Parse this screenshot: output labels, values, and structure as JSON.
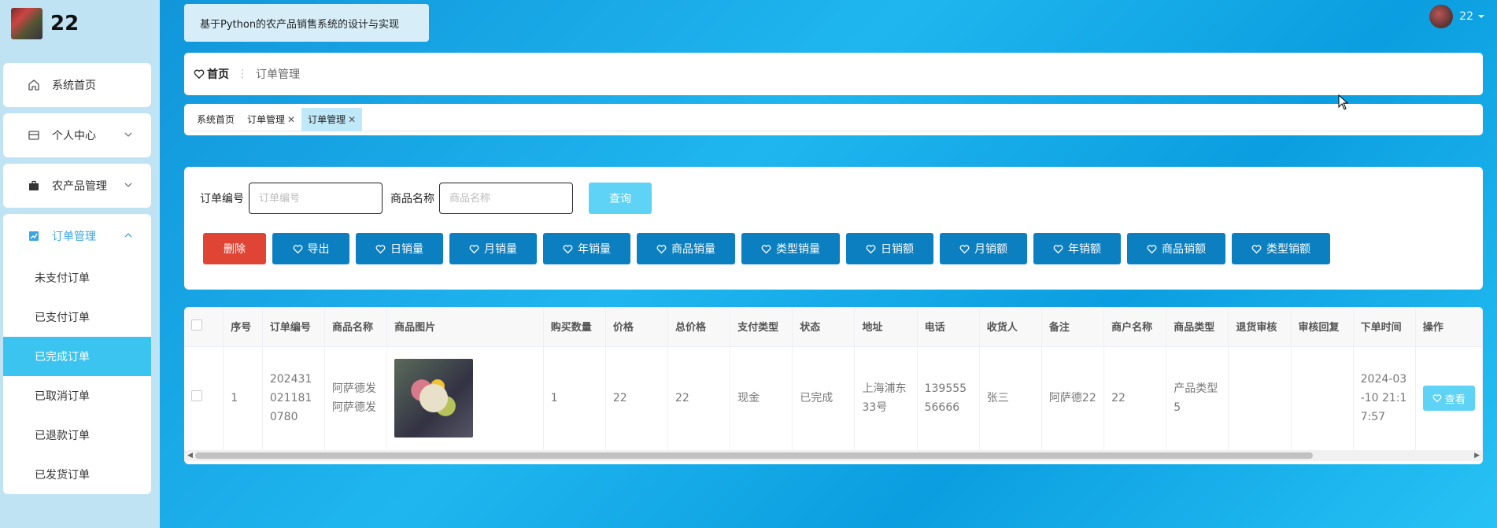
{
  "brand": {
    "name": "22"
  },
  "menu": {
    "items": [
      {
        "label": "系统首页",
        "icon": "home-icon"
      },
      {
        "label": "个人中心",
        "icon": "card-icon"
      },
      {
        "label": "农产品管理",
        "icon": "briefcase-icon"
      }
    ],
    "order_group": {
      "label": "订单管理",
      "icon": "chart-icon",
      "sub_items": [
        "未支付订单",
        "已支付订单",
        "已完成订单",
        "已取消订单",
        "已退款订单",
        "已发货订单"
      ],
      "active": "已完成订单"
    }
  },
  "header": {
    "title": "基于Python的农产品销售系统的设计与实现",
    "user": "22"
  },
  "breadcrumb": {
    "home": "首页",
    "current": "订单管理"
  },
  "tabs": [
    {
      "label": "系统首页",
      "closable": false
    },
    {
      "label": "订单管理",
      "closable": true
    },
    {
      "label": "订单管理",
      "closable": true,
      "active": true
    }
  ],
  "search": {
    "order_no_label": "订单编号",
    "order_no_placeholder": "订单编号",
    "goods_name_label": "商品名称",
    "goods_name_placeholder": "商品名称",
    "query_label": "查询"
  },
  "actions": {
    "delete": "删除",
    "export": "导出",
    "daily_sales": "日销量",
    "monthly_sales": "月销量",
    "yearly_sales": "年销量",
    "goods_sales": "商品销量",
    "type_sales": "类型销量",
    "daily_amount": "日销额",
    "monthly_amount": "月销额",
    "yearly_amount": "年销额",
    "goods_amount": "商品销额",
    "type_amount": "类型销额"
  },
  "table": {
    "headers": [
      "序号",
      "订单编号",
      "商品名称",
      "商品图片",
      "购买数量",
      "价格",
      "总价格",
      "支付类型",
      "状态",
      "地址",
      "电话",
      "收货人",
      "备注",
      "商户名称",
      "商品类型",
      "退货审核",
      "审核回复",
      "下单时间",
      "操作"
    ],
    "rows": [
      {
        "index": "1",
        "order_no": "2024310211810780",
        "goods_name": "阿萨德发阿萨德发",
        "quantity": "1",
        "price": "22",
        "total": "22",
        "pay_type": "现金",
        "status": "已完成",
        "address": "上海浦东33号",
        "phone": "13955556666",
        "receiver": "张三",
        "remark": "阿萨德22",
        "merchant": "22",
        "goods_type": "产品类型5",
        "return_review": "",
        "review_reply": "",
        "order_time": "2024-03-10 21:17:57",
        "view_label": "查看"
      }
    ]
  },
  "colors": {
    "accent": "#3cc4f0",
    "primary_btn": "#0b7fc0",
    "danger": "#e04434"
  }
}
